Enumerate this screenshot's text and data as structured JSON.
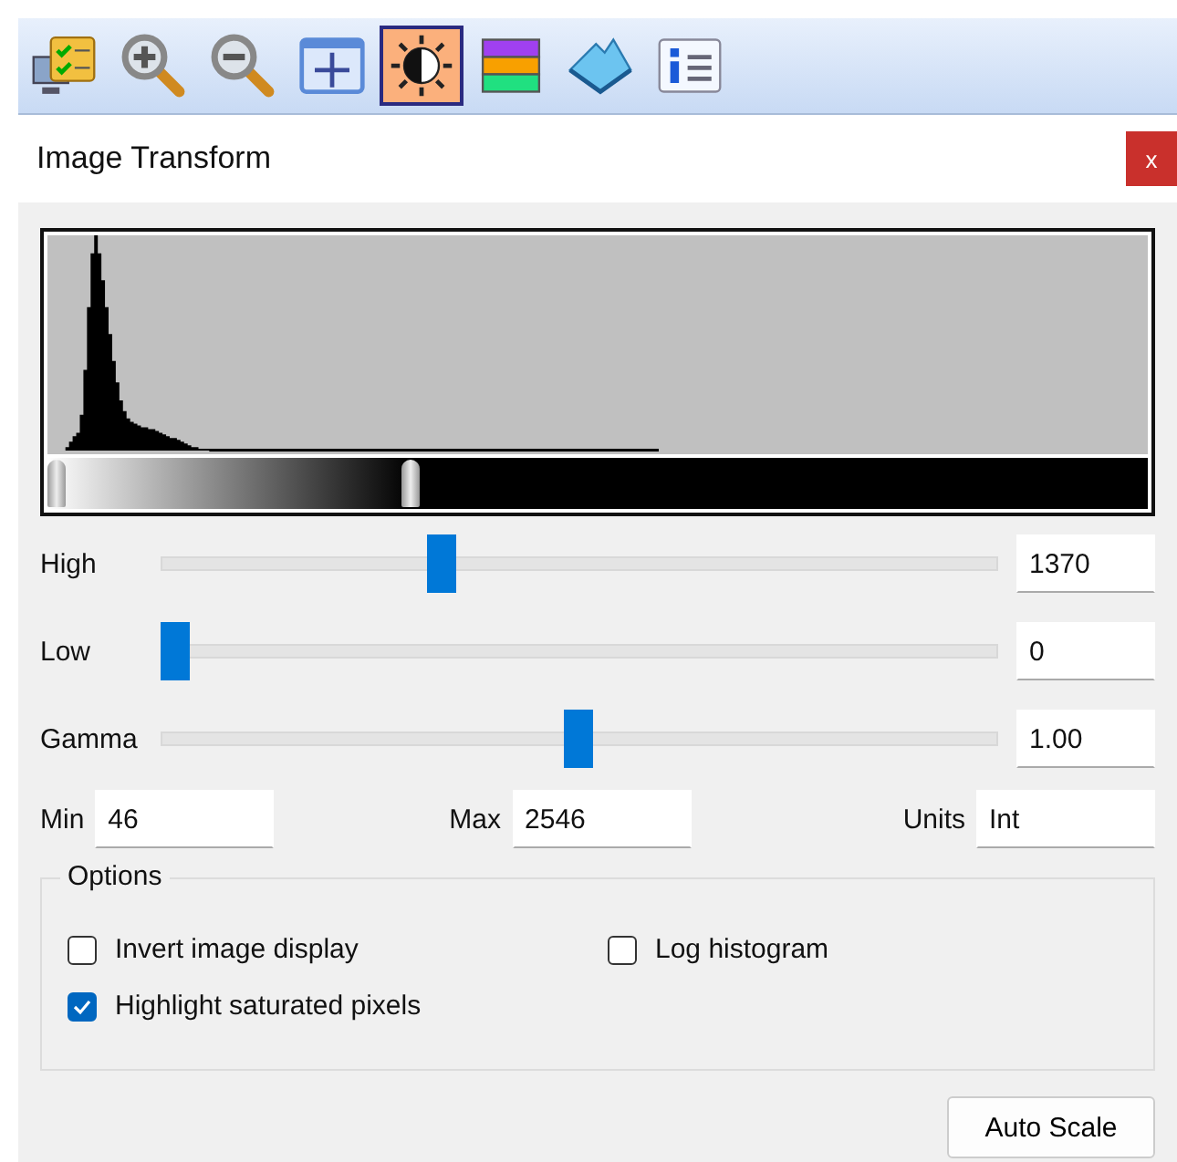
{
  "toolbar": {
    "buttons": [
      {
        "selected": false
      },
      {
        "selected": false
      },
      {
        "selected": false
      },
      {
        "selected": false
      },
      {
        "selected": true
      },
      {
        "selected": false
      },
      {
        "selected": false
      },
      {
        "selected": false
      }
    ]
  },
  "window": {
    "title": "Image Transform",
    "close": "x"
  },
  "histogram": {
    "colorbar": {
      "low": {
        "level": 0
      },
      "high": {
        "level": 0.33
      }
    }
  },
  "sliders": [
    {
      "label": "High",
      "level": 0.33,
      "value": "1370"
    },
    {
      "label": "Low",
      "level": 0,
      "value": "0"
    },
    {
      "label": "Gamma",
      "level": 0.5,
      "value": "1.00"
    }
  ],
  "range": [
    {
      "label": "Min",
      "value": "46"
    },
    {
      "label": "Max",
      "value": "2546"
    },
    {
      "label": "Units",
      "value": "Int"
    }
  ],
  "options": {
    "title": "Options",
    "checkboxes": [
      {
        "label": "Invert image display",
        "checked": false
      },
      {
        "label": "Log histogram",
        "checked": false
      },
      {
        "label": "Highlight saturated pixels",
        "checked": true
      }
    ]
  },
  "buttons": [
    {
      "label": "Auto Scale"
    }
  ]
}
